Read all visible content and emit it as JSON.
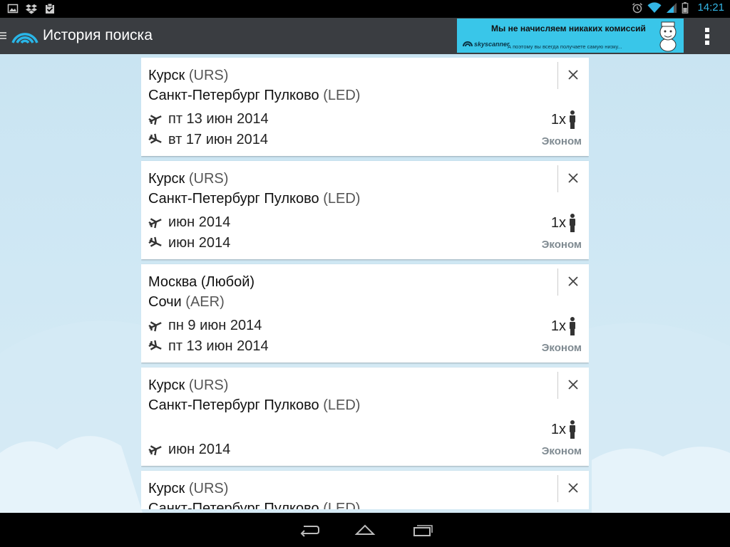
{
  "status_bar": {
    "time": "14:21",
    "left_icons": [
      "gallery-icon",
      "dropbox-icon",
      "clipboard-check-icon"
    ],
    "right_icons": [
      "alarm-icon",
      "wifi-icon",
      "signal-icon",
      "battery-icon"
    ]
  },
  "action_bar": {
    "title": "История поиска",
    "logo_icon": "skyscanner-logo-icon",
    "menu_icon": "overflow-menu-icon"
  },
  "ad": {
    "headline": "Мы не начисляем никаких комиссий",
    "brand": "skyscanner",
    "subtext": "А поэтому вы всегда получаете самую низку...",
    "background": "#39c6e9"
  },
  "colors": {
    "action_bar": "#3a3d41",
    "background_sky": "#cfe7f3",
    "cabin_text": "#7f8a91",
    "accent": "#33b5e5"
  },
  "searches": [
    {
      "origin_city": "Курск",
      "origin_code": "(URS)",
      "dest_city": "Санкт-Петербург Пулково",
      "dest_code": "(LED)",
      "outbound": "пт 13 июн 2014",
      "return": "вт 17 июн 2014",
      "passengers": "1x",
      "cabin": "Эконом"
    },
    {
      "origin_city": "Курск",
      "origin_code": "(URS)",
      "dest_city": "Санкт-Петербург Пулково",
      "dest_code": "(LED)",
      "outbound": "июн 2014",
      "return": "июн 2014",
      "passengers": "1x",
      "cabin": "Эконом"
    },
    {
      "origin_city": "Москва",
      "origin_code": "(Любой)",
      "dest_city": "Сочи",
      "dest_code": "(AER)",
      "outbound": "пн 9 июн 2014",
      "return": "пт 13 июн 2014",
      "passengers": "1x",
      "cabin": "Эконом"
    },
    {
      "origin_city": "Курск",
      "origin_code": "(URS)",
      "dest_city": "Санкт-Петербург Пулково",
      "dest_code": "(LED)",
      "outbound": "",
      "return": "",
      "single_date": "июн 2014",
      "passengers": "1x",
      "cabin": "Эконом"
    },
    {
      "origin_city": "Курск",
      "origin_code": "(URS)",
      "dest_city": "Санкт-Петербург Пулково",
      "dest_code": "(LED)",
      "outbound": "",
      "return": "",
      "passengers": "",
      "cabin": ""
    }
  ],
  "nav_bar": {
    "buttons": [
      "back-icon",
      "home-icon",
      "recent-apps-icon"
    ]
  }
}
